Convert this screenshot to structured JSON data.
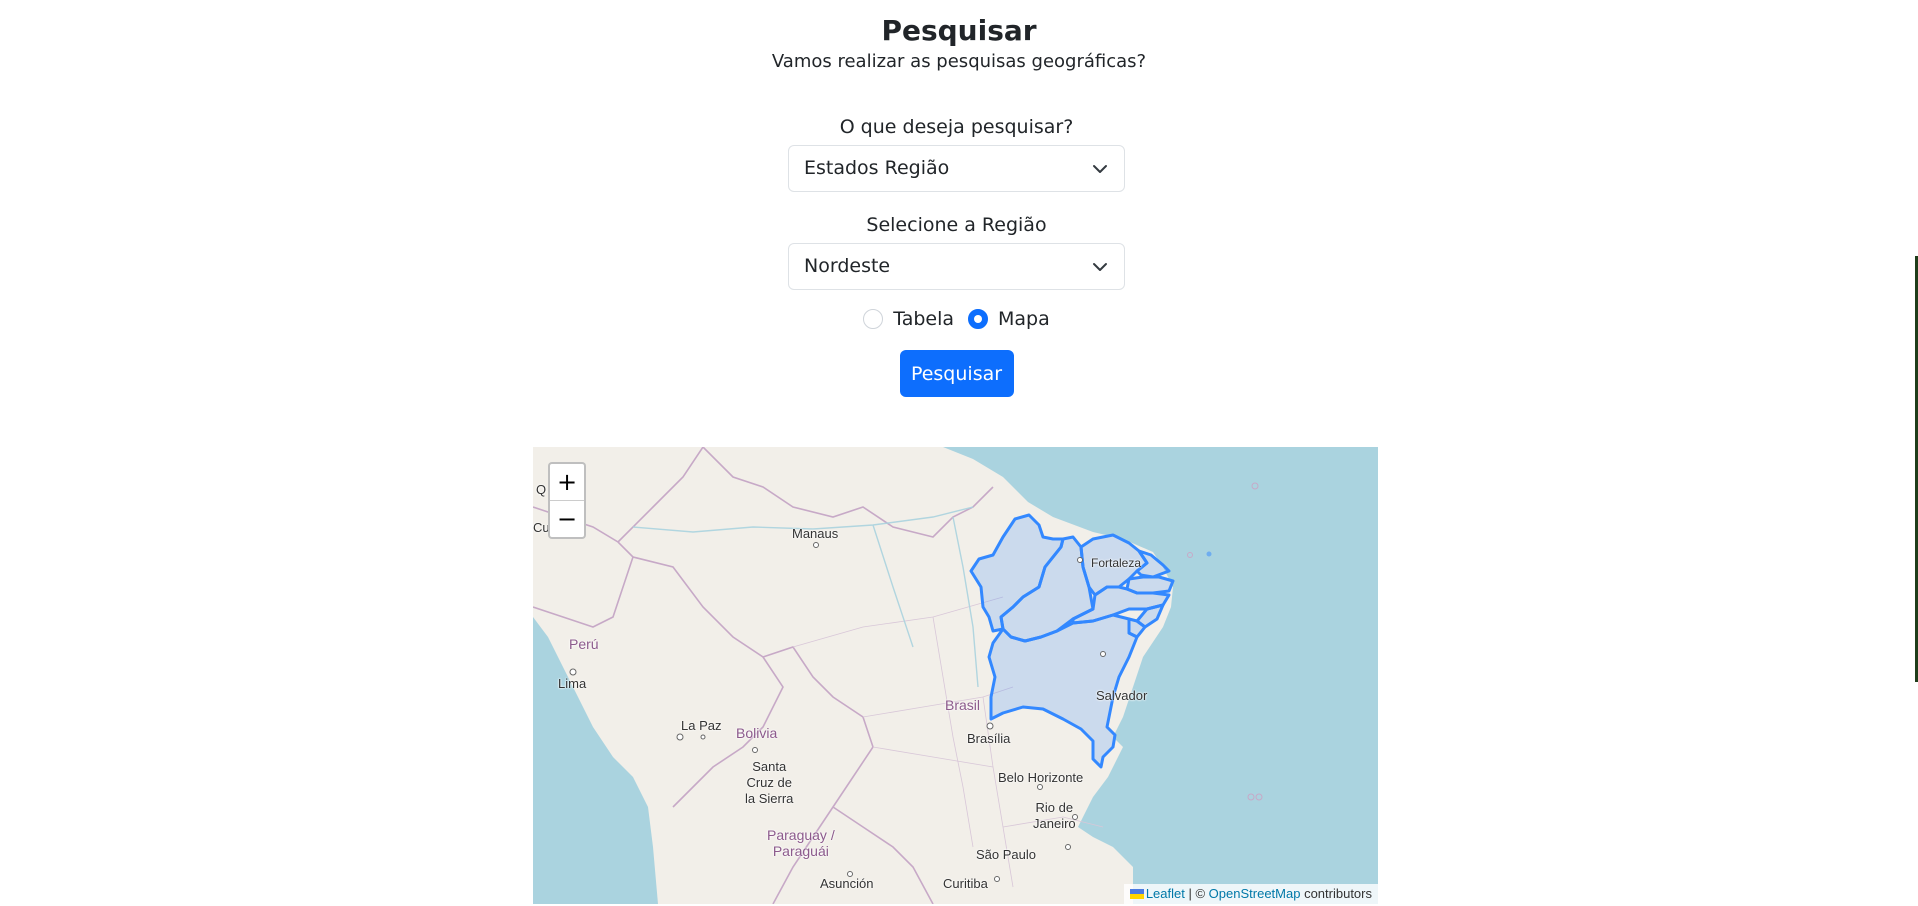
{
  "header": {
    "title": "Pesquisar",
    "subtitle": "Vamos realizar as pesquisas geográficas?"
  },
  "form": {
    "search_type_label": "O que deseja pesquisar?",
    "search_type_value": "Estados Região",
    "region_label": "Selecione a Região",
    "region_value": "Nordeste",
    "view_options": [
      {
        "label": "Tabela",
        "checked": false
      },
      {
        "label": "Mapa",
        "checked": true
      }
    ],
    "submit_label": "Pesquisar"
  },
  "map": {
    "zoom_in": "+",
    "zoom_out": "−",
    "labels": {
      "manaus": "Manaus",
      "fortaleza": "Fortaleza",
      "peru": "Perú",
      "lima": "Lima",
      "brasil": "Brasil",
      "salvador": "Salvador",
      "brasilia": "Brasília",
      "la_paz": "La Paz",
      "bolivia": "Bolivia",
      "santa_cruz": "Santa\nCruz de\nla Sierra",
      "belo_horizonte": "Belo Horizonte",
      "rio": "Rio de\nJaneiro",
      "paraguay": "Paraguay /\nParaguái",
      "sao_paulo": "São Paulo",
      "asuncion": "Asunción",
      "curitiba": "Curitiba",
      "q": "Q",
      "cu": "Cu"
    },
    "attribution": {
      "leaflet": "Leaflet",
      "separator": " | © ",
      "osm": "OpenStreetMap",
      "suffix": " contributors"
    },
    "colors": {
      "ocean": "#aad3df",
      "land": "#f2efe9",
      "highlight_stroke": "#3388ff",
      "highlight_fill": "#3388ff"
    }
  }
}
